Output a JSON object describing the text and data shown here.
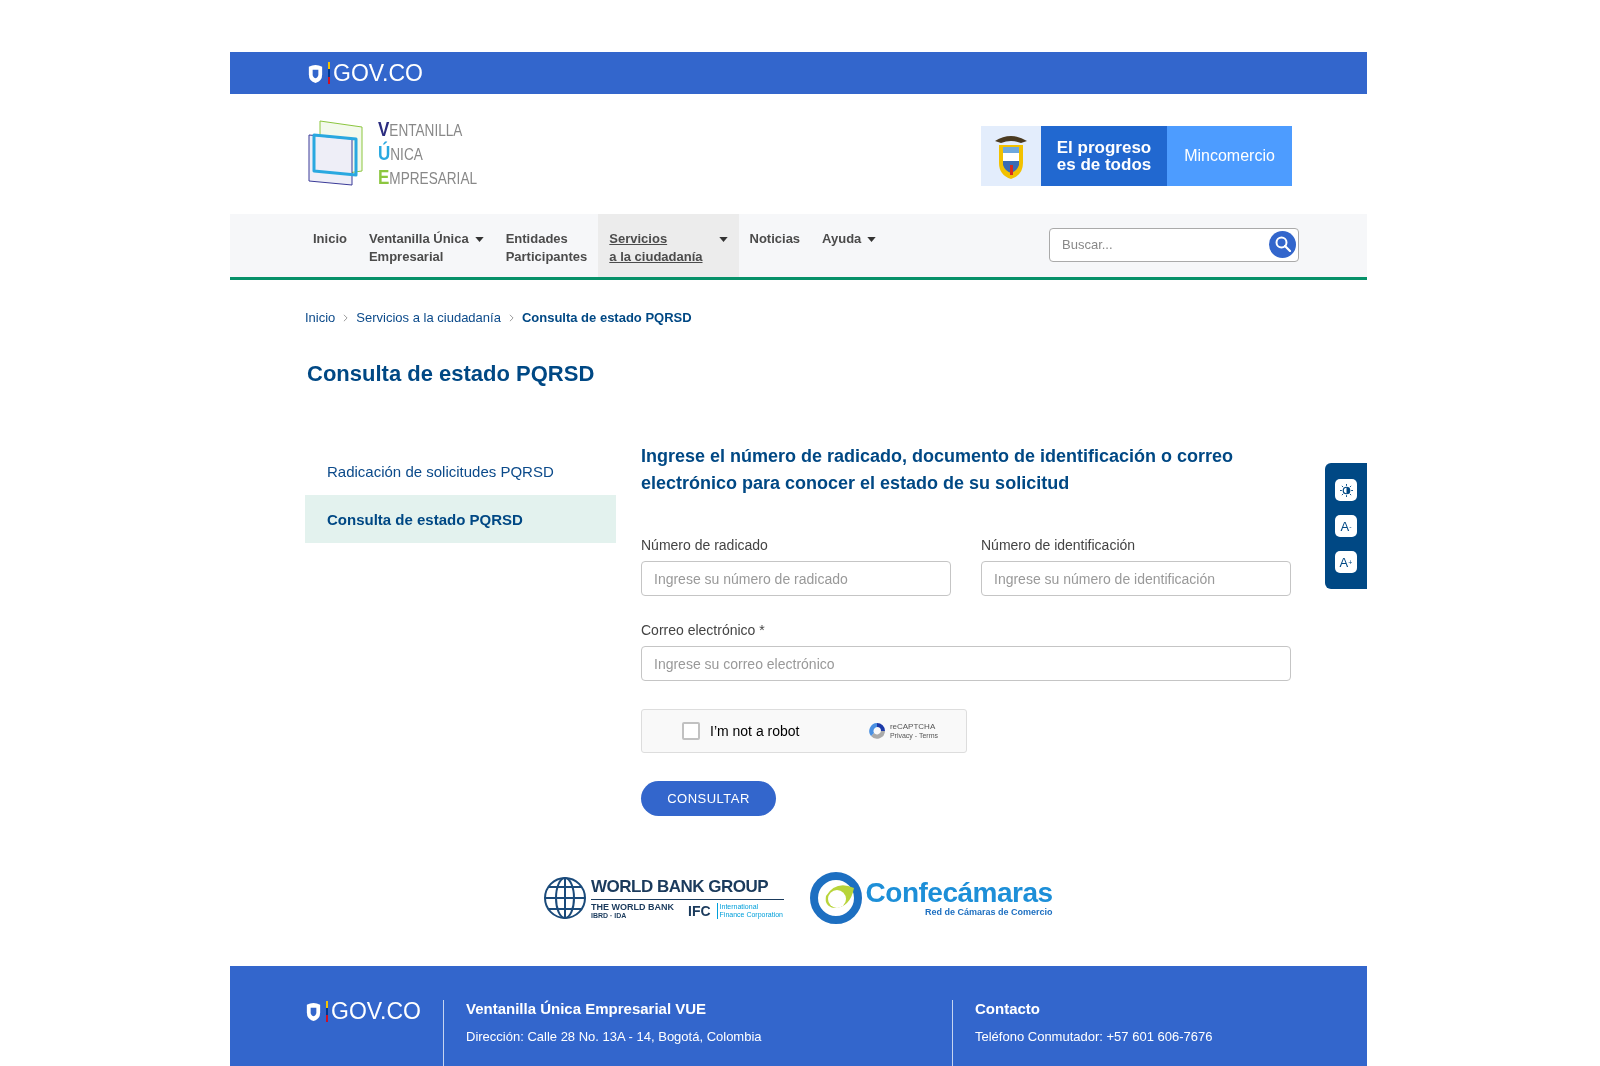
{
  "top_bar": {
    "brand": "GOV.CO"
  },
  "logo": {
    "lines": [
      "VENTANILLA",
      "ÚNICA",
      "EMPRESARIAL"
    ]
  },
  "banner": {
    "slogan_lines": [
      "El progreso",
      "es de todos"
    ],
    "ministry": "Mincomercio"
  },
  "nav": {
    "items": [
      {
        "lines": [
          "Inicio"
        ],
        "dropdown": false,
        "selected": false
      },
      {
        "lines": [
          "Ventanilla Única",
          "Empresarial"
        ],
        "dropdown": true,
        "selected": false
      },
      {
        "lines": [
          "Entidades",
          "Participantes"
        ],
        "dropdown": false,
        "selected": false
      },
      {
        "lines": [
          "Servicios",
          "a la ciudadanía"
        ],
        "dropdown": true,
        "selected": true
      },
      {
        "lines": [
          "Noticias"
        ],
        "dropdown": false,
        "selected": false
      },
      {
        "lines": [
          "Ayuda"
        ],
        "dropdown": true,
        "selected": false
      }
    ],
    "search": {
      "placeholder": "Buscar..."
    }
  },
  "breadcrumb": [
    {
      "label": "Inicio",
      "current": false
    },
    {
      "label": "Servicios a la ciudadanía",
      "current": false
    },
    {
      "label": "Consulta de estado PQRSD",
      "current": true
    }
  ],
  "page_title": "Consulta de estado PQRSD",
  "sidebar": {
    "items": [
      {
        "label": "Radicación de solicitudes PQRSD",
        "selected": false
      },
      {
        "label": "Consulta de estado PQRSD",
        "selected": true
      }
    ]
  },
  "form": {
    "heading": "Ingrese el número de radicado, documento de identificación o correo electrónico para conocer el estado de su solicitud",
    "fields": [
      {
        "label": "Número de radicado",
        "placeholder": "Ingrese su número de radicado",
        "wide": false
      },
      {
        "label": "Número de identificación",
        "placeholder": "Ingrese su número de identificación",
        "wide": false
      },
      {
        "label": "Correo electrónico *",
        "placeholder": "Ingrese su correo electrónico",
        "wide": true
      }
    ],
    "captcha": {
      "label": "I’m not a robot",
      "checked": false,
      "brand": "reCAPTCHA",
      "links": "Privacy - Terms"
    },
    "submit": "CONSULTAR"
  },
  "accessibility": {
    "buttons": [
      {
        "kind": "contrast"
      },
      {
        "kind": "text",
        "label": "A$^{-}$"
      },
      {
        "kind": "text",
        "label": "A$^{+}$"
      }
    ]
  },
  "partners": {
    "world_bank": {
      "title": "WORLD BANK GROUP",
      "bank": "THE WORLD BANK",
      "bank_sub": "IBRD · IDA",
      "ifc": "IFC",
      "ifc_sub": "International Finance Corporation"
    },
    "confecamaras": {
      "name": "Confecámaras",
      "tagline": "Red de Cámaras de Comercio"
    }
  },
  "footer": {
    "brand": "GOV.CO",
    "columns": [
      {
        "title": "Ventanilla Única Empresarial VUE",
        "line": "Dirección: Calle 28 No. 13A - 14, Bogotá, Colombia"
      },
      {
        "title": "Contacto",
        "line": "Teléfono Conmutador: +57 601 606-7676"
      }
    ]
  }
}
